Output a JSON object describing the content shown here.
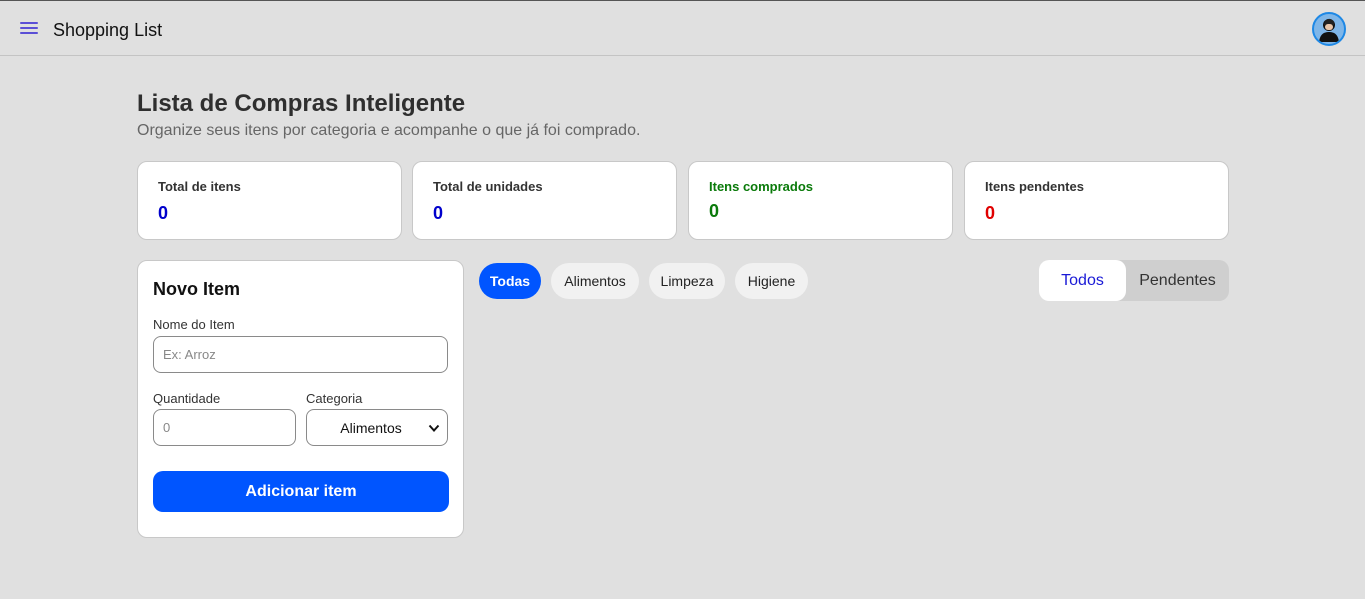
{
  "header": {
    "app_title": "Shopping List",
    "menu_icon": "hamburger-menu-icon",
    "avatar_icon": "user-avatar-icon",
    "accent": "#5b4fd6"
  },
  "main": {
    "title": "Lista de Compras Inteligente",
    "subtitle": "Organize seus itens por categoria e acompanhe o que já foi comprado."
  },
  "stats": [
    {
      "label": "Total de itens",
      "value": "0",
      "label_color": "#333333",
      "value_color": "#0000cc"
    },
    {
      "label": "Total de unidades",
      "value": "0",
      "label_color": "#333333",
      "value_color": "#0000cc"
    },
    {
      "label": "Itens comprados",
      "value": "0",
      "label_color": "#0a7a0a",
      "value_color": "#0a7a0a"
    },
    {
      "label": "Itens pendentes",
      "value": "0",
      "label_color": "#333333",
      "value_color": "#e00000"
    }
  ],
  "form": {
    "title": "Novo Item",
    "name_label": "Nome do Item",
    "name_placeholder": "Ex: Arroz",
    "name_value": "",
    "quantity_label": "Quantidade",
    "quantity_placeholder": "0",
    "quantity_value": "",
    "category_label": "Categoria",
    "category_selected": "Alimentos",
    "submit_label": "Adicionar item",
    "primary_color": "#0055ff"
  },
  "category_filters": [
    {
      "label": "Todas",
      "active": true
    },
    {
      "label": "Alimentos",
      "active": false
    },
    {
      "label": "Limpeza",
      "active": false
    },
    {
      "label": "Higiene",
      "active": false
    }
  ],
  "status_toggle": [
    {
      "label": "Todos",
      "active": true
    },
    {
      "label": "Pendentes",
      "active": false
    }
  ]
}
